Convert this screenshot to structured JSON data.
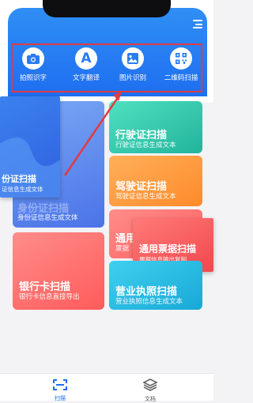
{
  "tools": [
    {
      "label": "拍照识字",
      "icon": "camera-icon"
    },
    {
      "label": "文字翻译",
      "icon": "letter-a-icon"
    },
    {
      "label": "图片识别",
      "icon": "image-icon"
    },
    {
      "label": "二维码扫描",
      "icon": "qr-code-icon"
    }
  ],
  "cards": {
    "id_card": {
      "title": "身份证扫描",
      "subtitle": "身份证信息生成文体"
    },
    "id_card_popup": {
      "title": "份证扫描",
      "subtitle": "证信息生成文体"
    },
    "driving": {
      "title": "行驶证扫描",
      "subtitle": "行驶证信息生成文本"
    },
    "license": {
      "title": "驾驶证扫描",
      "subtitle": "驾驶证信息生成文本"
    },
    "bank": {
      "title": "银行卡扫描",
      "subtitle": "银行卡信息直接导出"
    },
    "ticket": {
      "title": "通用票据扫描",
      "subtitle": "票据信息输出复制"
    },
    "ticket_behind": {
      "title": "通用",
      "subtitle": "票据"
    },
    "business": {
      "title": "营业执照扫描",
      "subtitle": "营业执照信息生成文本"
    }
  },
  "nav": [
    {
      "icon": "scan-icon",
      "label": "扫描"
    },
    {
      "icon": "layers-icon",
      "label": "文档"
    }
  ],
  "colors": {
    "brand": "#1f6ef0",
    "highlight": "#e23a40"
  }
}
